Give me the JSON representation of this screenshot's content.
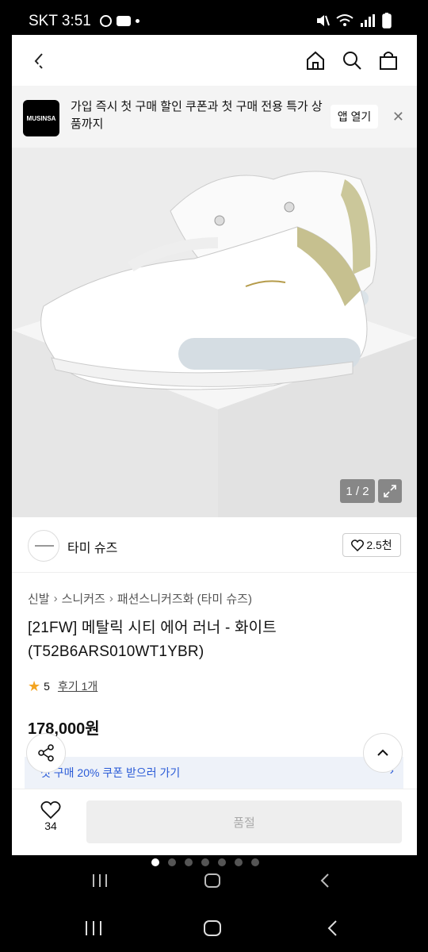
{
  "status": {
    "time": "SKT 3:51"
  },
  "banner": {
    "logo_text": "MUSINSA",
    "message": "가입 즉시 첫 구매 할인 쿠폰과 첫 구매 전용 특가 상품까지",
    "open_label": "앱 열기",
    "close_label": "✕"
  },
  "gallery": {
    "counter": "1 / 2"
  },
  "brand": {
    "name": "타미 슈즈",
    "likes": "2.5천"
  },
  "breadcrumb": [
    "신발",
    "스니커즈",
    "패션스니커즈화 (타미 슈즈)"
  ],
  "product": {
    "title": "[21FW] 메탈릭 시티 에어 러너 - 화이트(T52B6ARS010WT1YBR)",
    "rating": "5",
    "review_link": "후기 1개",
    "price": "178,000원"
  },
  "coupon": {
    "text": "첫 구매 20% 쿠폰 받으러 가기"
  },
  "bottom": {
    "wish_count": "34",
    "soldout_label": "품절"
  },
  "colors": {
    "accent_blue": "#2a5bd7",
    "star": "#f3a421",
    "image_bg": "#ececec"
  }
}
